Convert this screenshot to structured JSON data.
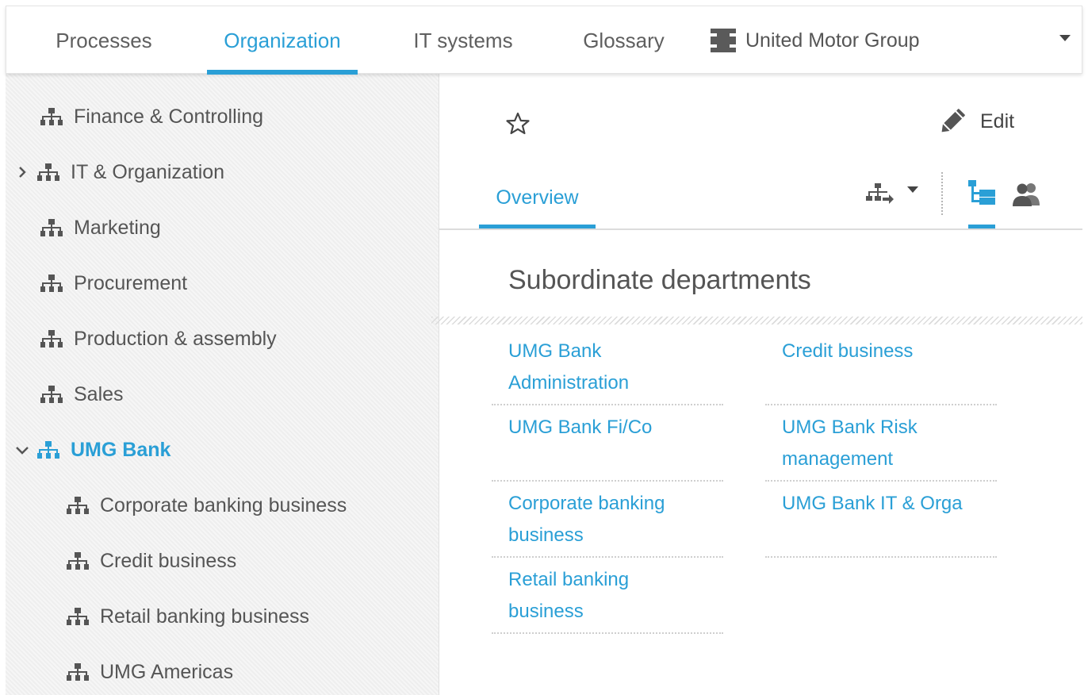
{
  "nav": {
    "tabs": [
      {
        "label": "Processes",
        "active": false
      },
      {
        "label": "Organization",
        "active": true
      },
      {
        "label": "IT systems",
        "active": false
      },
      {
        "label": "Glossary",
        "active": false
      }
    ],
    "org_switch": {
      "label": "United Motor Group",
      "icon": "building-icon"
    }
  },
  "sidebar": {
    "items": [
      {
        "label": "Finance & Controlling",
        "level": 0,
        "expander": "none"
      },
      {
        "label": "IT & Organization",
        "level": 0,
        "expander": "collapsed"
      },
      {
        "label": "Marketing",
        "level": 0,
        "expander": "none"
      },
      {
        "label": "Procurement",
        "level": 0,
        "expander": "none"
      },
      {
        "label": "Production & assembly",
        "level": 0,
        "expander": "none"
      },
      {
        "label": "Sales",
        "level": 0,
        "expander": "none"
      },
      {
        "label": "UMG Bank",
        "level": 0,
        "expander": "expanded",
        "selected": true
      },
      {
        "label": "Corporate banking business",
        "level": 1,
        "expander": "none"
      },
      {
        "label": "Credit business",
        "level": 1,
        "expander": "none"
      },
      {
        "label": "Retail banking business",
        "level": 1,
        "expander": "none"
      },
      {
        "label": "UMG Americas",
        "level": 1,
        "expander": "none"
      }
    ]
  },
  "main": {
    "edit_label": "Edit",
    "subtab_label": "Overview",
    "section_title": "Subordinate departments",
    "departments_left": [
      {
        "line1": "UMG Bank",
        "line2": "Administration"
      },
      {
        "line1": "UMG Bank Fi/Co",
        "line2": ""
      },
      {
        "line1": "Corporate banking",
        "line2": "business"
      },
      {
        "line1": "Retail banking",
        "line2": "business"
      }
    ],
    "departments_right": [
      {
        "line1": "Credit business",
        "line2": ""
      },
      {
        "line1": "UMG Bank Risk",
        "line2": "management"
      },
      {
        "line1": "UMG Bank IT & Orga",
        "line2": ""
      }
    ]
  },
  "colors": {
    "accent": "#2a9fd6",
    "text": "#555555",
    "sidebar_bg": "#f2f2f2"
  }
}
